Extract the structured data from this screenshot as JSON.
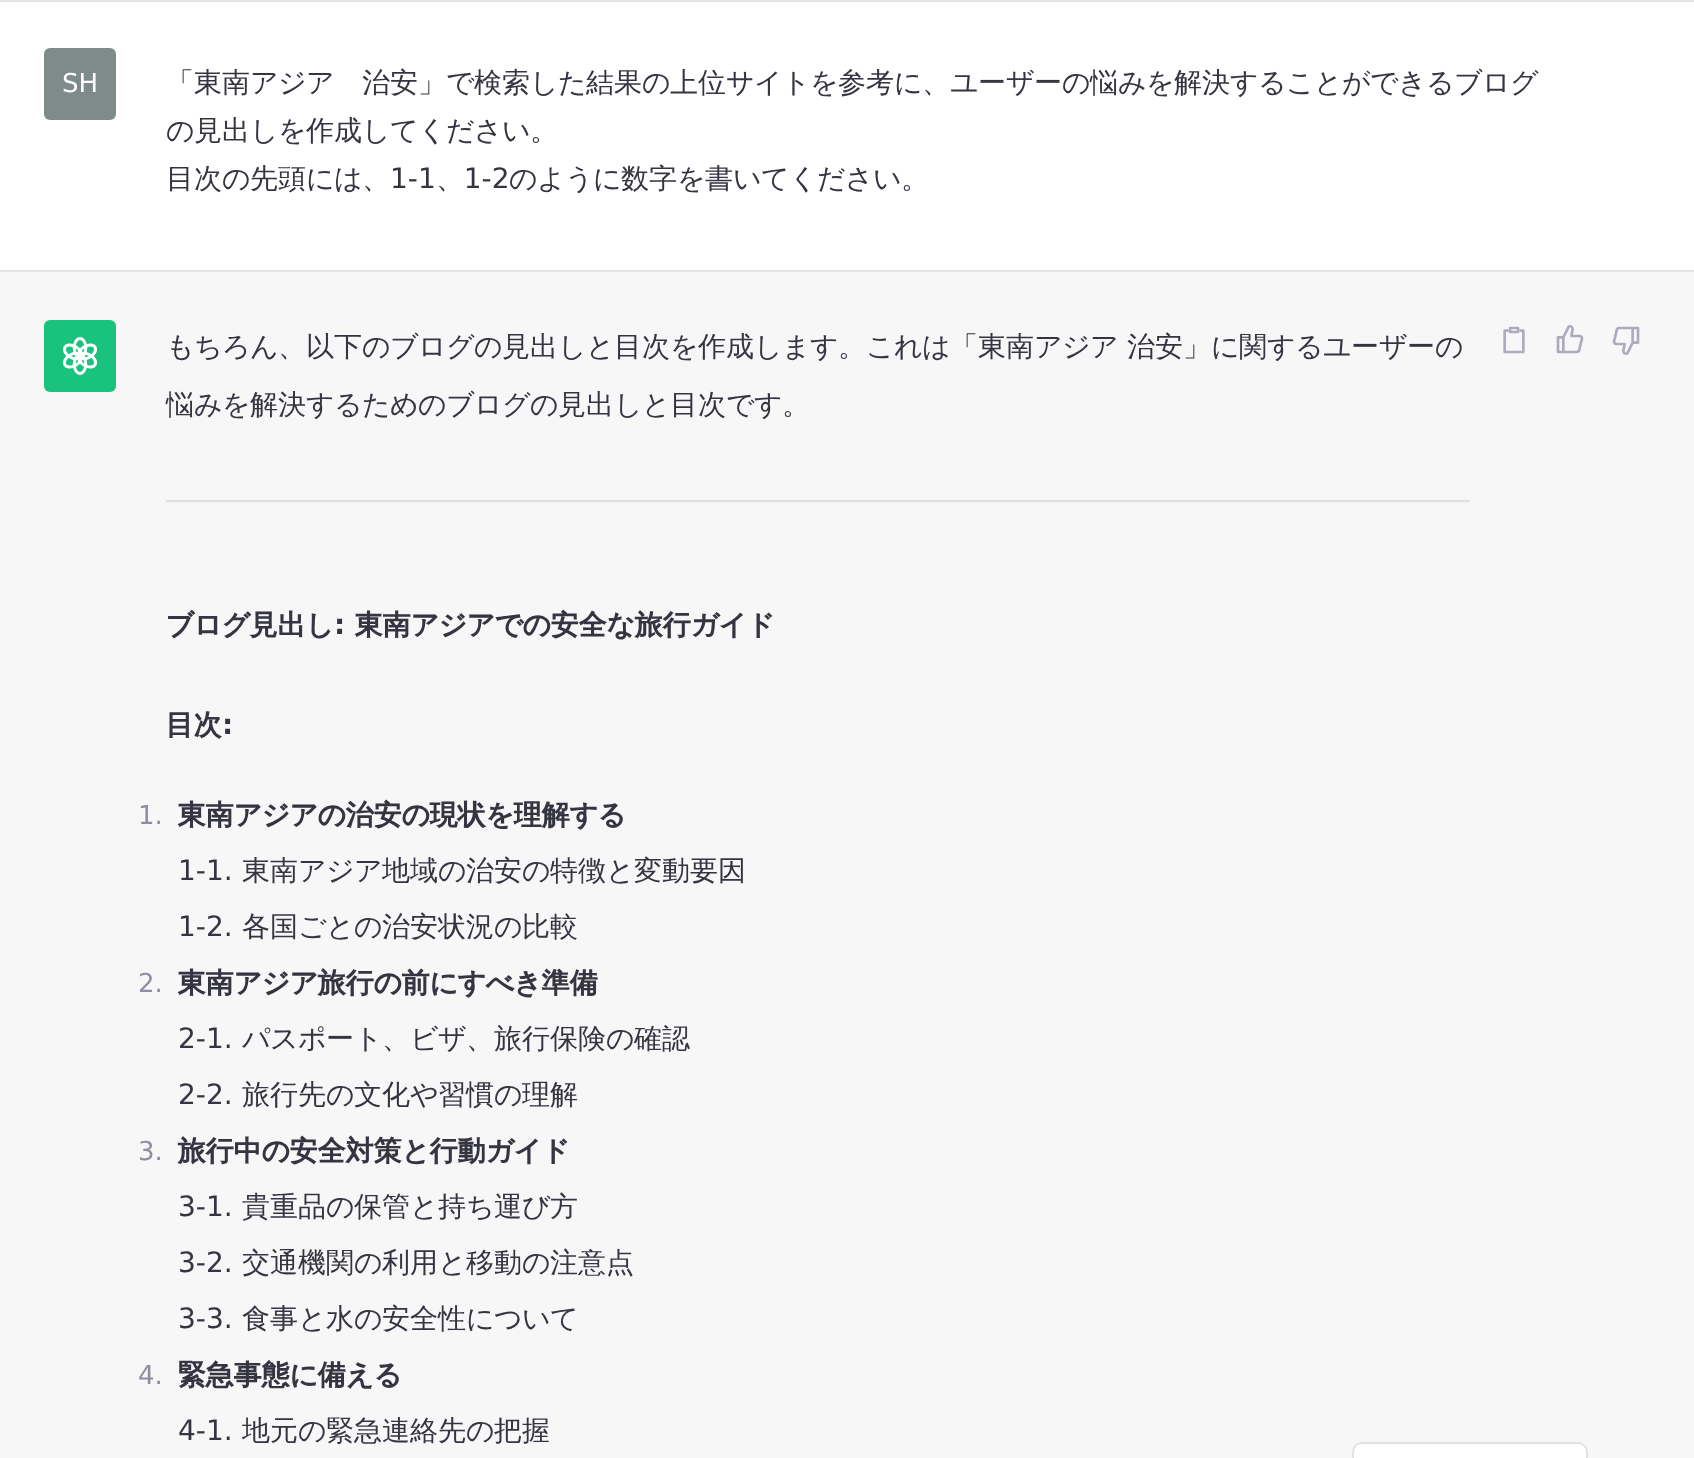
{
  "user_message": {
    "avatar": "SH",
    "lines": [
      "「東南アジア　治安」で検索した結果の上位サイトを参考に、ユーザーの悩みを解決することができるブログ",
      "の見出しを作成してください。",
      "目次の先頭には、1-1、1-2のように数字を書いてください。"
    ]
  },
  "assistant_message": {
    "intro": "もちろん、以下のブログの見出しと目次を作成します。これは「東南アジア 治安」に関するユーザーの悩みを解決するためのブログの見出しと目次です。",
    "heading": "ブログ見出し: 東南アジアでの安全な旅行ガイド",
    "toc_label": "目次:",
    "sections": [
      {
        "number": "1.",
        "title": "東南アジアの治安の現状を理解する",
        "items": [
          "1-1. 東南アジア地域の治安の特徴と変動要因",
          "1-2. 各国ごとの治安状況の比較"
        ]
      },
      {
        "number": "2.",
        "title": "東南アジア旅行の前にすべき準備",
        "items": [
          "2-1. パスポート、ビザ、旅行保険の確認",
          "2-2. 旅行先の文化や習慣の理解"
        ]
      },
      {
        "number": "3.",
        "title": "旅行中の安全対策と行動ガイド",
        "items": [
          "3-1. 貴重品の保管と持ち運び方",
          "3-2. 交通機関の利用と移動の注意点",
          "3-3. 食事と水の安全性について"
        ]
      },
      {
        "number": "4.",
        "title": "緊急事態に備える",
        "items": [
          "4-1. 地元の緊急連絡先の把握"
        ]
      }
    ]
  }
}
